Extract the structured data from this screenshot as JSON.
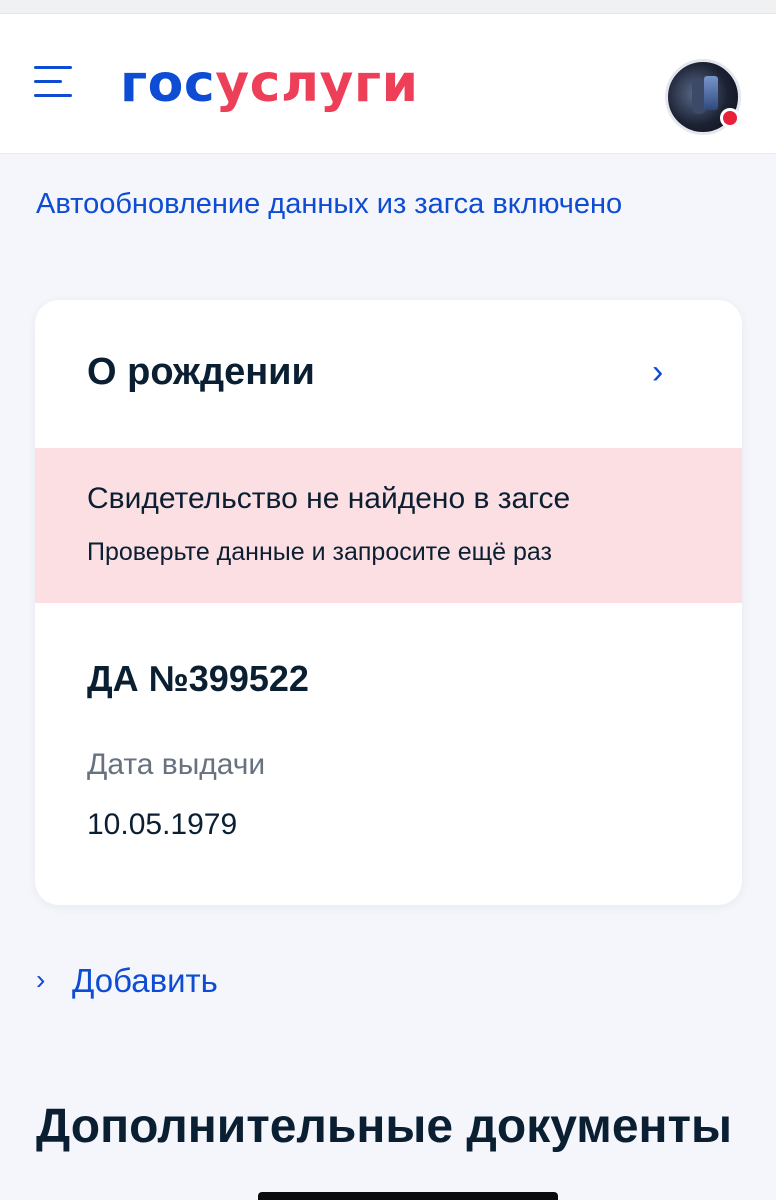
{
  "header": {
    "logo_gos": "гос",
    "logo_uslugi": "услуги",
    "avatar_notification": true
  },
  "autoupdate_text": "Автообновление данных из загса включено",
  "card": {
    "title": "О рождении",
    "chevron": "›",
    "alert": {
      "title": "Свидетельство не найдено в загсе",
      "subtitle": "Проверьте данные и запросите ещё раз",
      "color": "#fbdfe2"
    },
    "doc_number": "ДА №399522",
    "issue_label": "Дата выдачи",
    "issue_date": "10.05.1979"
  },
  "add_link": {
    "chevron": "›",
    "label": "Добавить"
  },
  "section_title": "Дополнительные документы",
  "colors": {
    "accent": "#0d4cd3",
    "brand_red": "#ee3f58",
    "background": "#f4f6fb"
  }
}
